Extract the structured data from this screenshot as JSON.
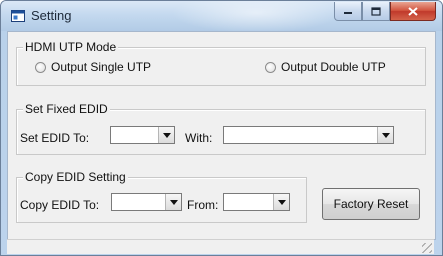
{
  "window": {
    "title": "Setting"
  },
  "hdmi_mode": {
    "group_title": "HDMI UTP Mode",
    "option_single": "Output Single UTP",
    "option_double": "Output Double UTP"
  },
  "fixed_edid": {
    "group_title": "Set Fixed EDID",
    "set_label": "Set EDID To:",
    "with_label": "With:",
    "set_value": "",
    "with_value": ""
  },
  "copy_edid": {
    "group_title": "Copy EDID Setting",
    "to_label": "Copy EDID To:",
    "from_label": "From:",
    "to_value": "",
    "from_value": ""
  },
  "factory_reset_label": "Factory Reset",
  "status_text": ""
}
